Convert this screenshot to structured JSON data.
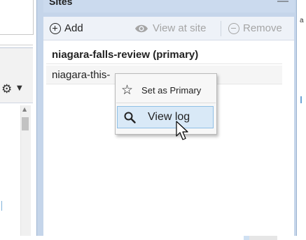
{
  "panel": {
    "title": "Sites",
    "minimize_label": "—",
    "toolbar": {
      "add_label": "Add",
      "view_label": "View at site",
      "remove_label": "Remove"
    },
    "rows": [
      {
        "label": "niagara-falls-review (primary)"
      },
      {
        "label": "niagara-this-"
      }
    ]
  },
  "context_menu": {
    "items": [
      {
        "label": "Set as Primary",
        "icon": "star-outline-icon"
      },
      {
        "label": "View log",
        "icon": "magnifier-icon"
      }
    ]
  },
  "colors": {
    "panel_header": "#cbdaee",
    "menu_highlight": "#d9e9f7",
    "disabled_text": "#a5a5a5"
  }
}
